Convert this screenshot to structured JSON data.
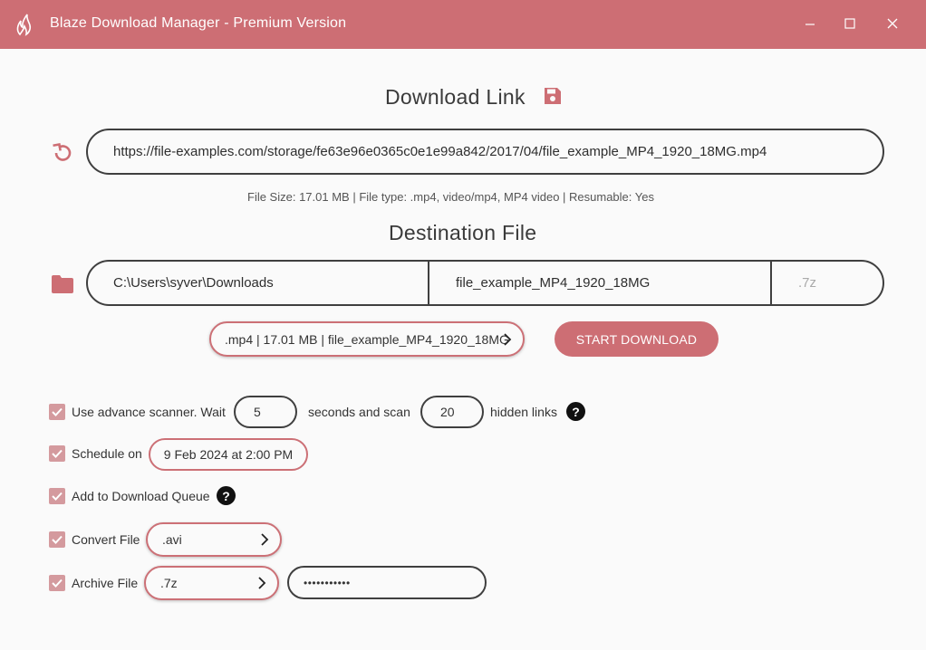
{
  "window": {
    "title": "Blaze Download Manager - Premium Version"
  },
  "download": {
    "heading": "Download Link",
    "url": "https://file-examples.com/storage/fe63e96e0365c0e1e99a842/2017/04/file_example_MP4_1920_18MG.mp4",
    "file_info": "File Size: 17.01 MB | File type: .mp4, video/mp4, MP4 video | Resumable: Yes"
  },
  "destination": {
    "heading": "Destination File",
    "folder": "C:\\Users\\syver\\Downloads",
    "filename": "file_example_MP4_1920_18MG",
    "extension_placeholder": ".7z",
    "summary": ".mp4 | 17.01 MB | file_example_MP4_1920_18MG"
  },
  "actions": {
    "start_label": "START DOWNLOAD"
  },
  "options": {
    "scanner": {
      "label": "Use advance scanner. Wait",
      "seconds": "5",
      "middle_label": "seconds and scan",
      "links": "20",
      "end_label": "hidden links",
      "checked": true
    },
    "schedule": {
      "label": "Schedule on",
      "value": "9 Feb 2024 at 2:00 PM",
      "checked": true
    },
    "queue": {
      "label": "Add to Download Queue",
      "checked": true
    },
    "convert": {
      "label": "Convert File",
      "value": ".avi",
      "checked": true
    },
    "archive": {
      "label": "Archive File",
      "value": ".7z",
      "password": "•••••••••••",
      "checked": true
    }
  },
  "colors": {
    "accent": "#cd6e74",
    "check": "#d49a9e",
    "border": "#3f3f3f"
  },
  "icons": {
    "app": "flame-icon",
    "save": "floppy-disk-icon",
    "refresh": "refresh-icon",
    "folder": "folder-icon",
    "help": "help-circle-icon",
    "chevron": "chevron-right-icon"
  }
}
